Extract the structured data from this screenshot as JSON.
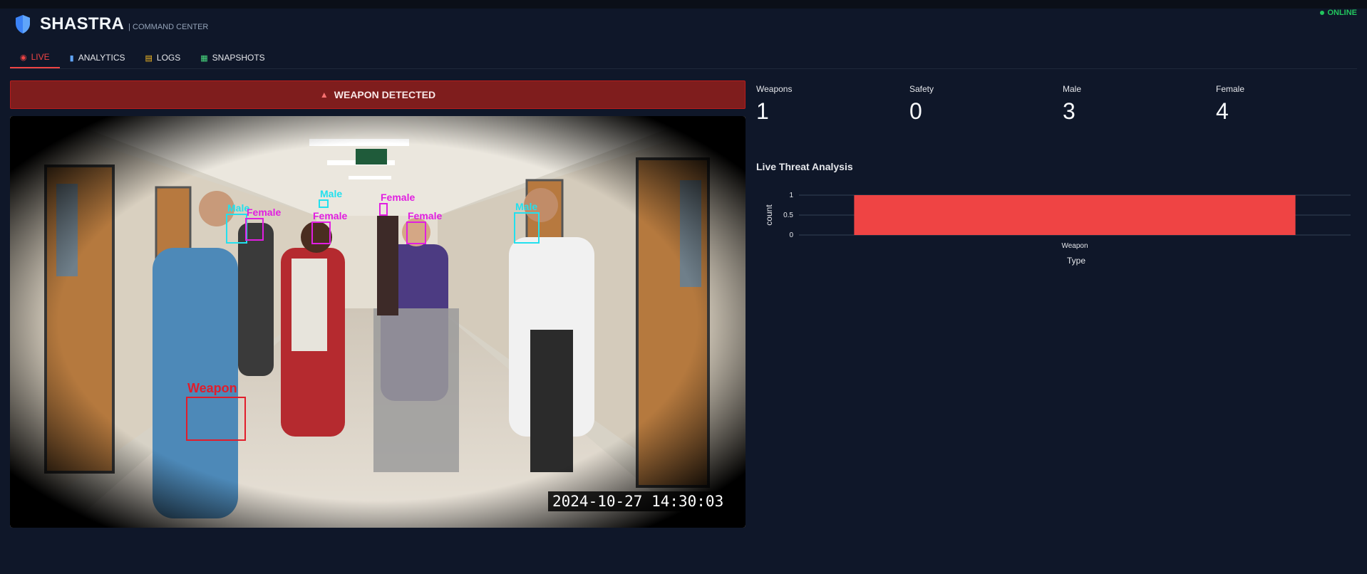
{
  "status": {
    "label": "ONLINE",
    "color": "#22c55e"
  },
  "brand": {
    "icon": "shield-icon",
    "name": "SHASTRA",
    "subtitle": "| COMMAND CENTER"
  },
  "tabs": [
    {
      "label": "LIVE",
      "icon": "camera-icon",
      "active": true
    },
    {
      "label": "ANALYTICS",
      "icon": "bar-chart-icon",
      "active": false
    },
    {
      "label": "LOGS",
      "icon": "scroll-icon",
      "active": false
    },
    {
      "label": "SNAPSHOTS",
      "icon": "image-icon",
      "active": false
    }
  ],
  "alert": {
    "icon": "siren-icon",
    "text": "WEAPON DETECTED",
    "color": "#7f1d1d"
  },
  "feed": {
    "timestamp": "2024-10-27 14:30:03",
    "detections": [
      {
        "label": "Male"
      },
      {
        "label": "Female"
      },
      {
        "label": "Male"
      },
      {
        "label": "Female"
      },
      {
        "label": "Female"
      },
      {
        "label": "Female"
      },
      {
        "label": "Male"
      },
      {
        "label": "Weapon"
      }
    ]
  },
  "metrics": [
    {
      "label": "Weapons",
      "value": "1"
    },
    {
      "label": "Safety",
      "value": "0"
    },
    {
      "label": "Male",
      "value": "3"
    },
    {
      "label": "Female",
      "value": "4"
    }
  ],
  "chart_title": "Live Threat Analysis",
  "chart_data": {
    "type": "bar",
    "categories": [
      "Weapon"
    ],
    "values": [
      1
    ],
    "xlabel": "Type",
    "ylabel": "count",
    "yticks": [
      "0",
      "0.5",
      "1"
    ],
    "ylim": [
      0,
      1
    ],
    "bar_color": "#ef4444",
    "grid": true
  }
}
